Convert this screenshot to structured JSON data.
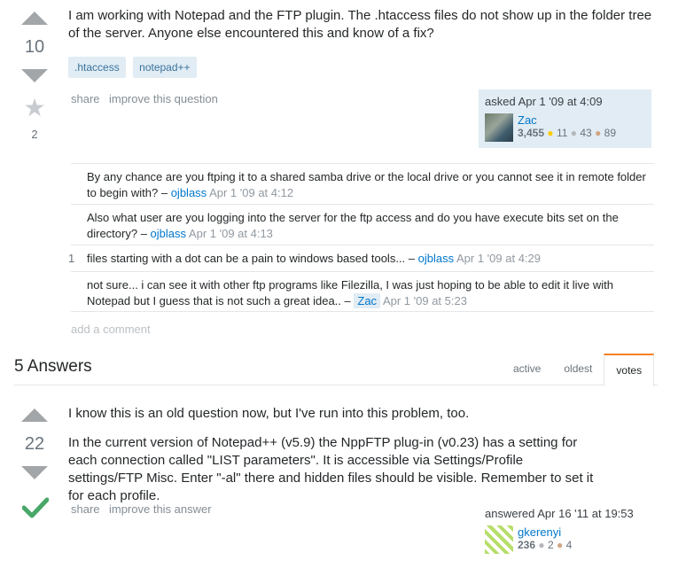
{
  "question": {
    "vote_count": "10",
    "favorite_count": "2",
    "text": "I am working with Notepad and the FTP plugin. The .htaccess files do not show up in the folder tree of the server. Anyone else encountered this and know of a fix?",
    "tags": [
      ".htaccess",
      "notepad++"
    ],
    "menu": {
      "share": "share",
      "improve": "improve this question"
    },
    "owner": {
      "asked": "asked Apr 1 '09 at 4:09",
      "name": "Zac",
      "reputation": "3,455",
      "gold_dot": "●",
      "gold": "11",
      "silver_dot": "●",
      "silver": "43",
      "bronze_dot": "●",
      "bronze": "89"
    }
  },
  "comments": [
    {
      "score": "",
      "text": "By any chance are you ftping it to a shared samba drive or the local drive or you cannot see it in remote folder to begin with? –",
      "user": "ojblass",
      "date": "Apr 1 '09 at 4:12"
    },
    {
      "score": "",
      "text": "Also what user are you logging into the server for the ftp access and do you have execute bits set on the directory? –",
      "user": "ojblass",
      "date": "Apr 1 '09 at 4:13"
    },
    {
      "score": "1",
      "text": "files starting with a dot can be a pain to windows based tools... –",
      "user": "ojblass",
      "date": "Apr 1 '09 at 4:29"
    },
    {
      "score": "",
      "text": "not sure... i can see it with other ftp programs like Filezilla, I was just hoping to be able to edit it live with Notepad but I guess that is not such a great idea.. –",
      "user": "Zac",
      "date": "Apr 1 '09 at 5:23"
    }
  ],
  "add_comment": "add a comment",
  "answers_header": {
    "title": "5 Answers",
    "tabs": [
      "active",
      "oldest",
      "votes"
    ]
  },
  "answer": {
    "vote_count": "22",
    "paragraph1": "I know this is an old question now, but I've run into this problem, too.",
    "paragraph2": "In the current version of Notepad++ (v5.9) the NppFTP plug-in (v0.23) has a setting for each connection called \"LIST parameters\". It is accessible via Settings/Profile settings/FTP Misc. Enter \"-al\" there and hidden files should be visible. Remember to set it for each profile.",
    "menu": {
      "share": "share",
      "improve": "improve this answer"
    },
    "owner": {
      "answered": "answered Apr 16 '11 at 19:53",
      "name": "gkerenyi",
      "reputation": "236",
      "silver_dot": "●",
      "silver": "2",
      "bronze_dot": "●",
      "bronze": "4"
    }
  },
  "colors": {
    "accent": "#f48024",
    "link": "#0077cc",
    "tag_bg": "#e1ecf4",
    "accepted": "#48a868"
  }
}
